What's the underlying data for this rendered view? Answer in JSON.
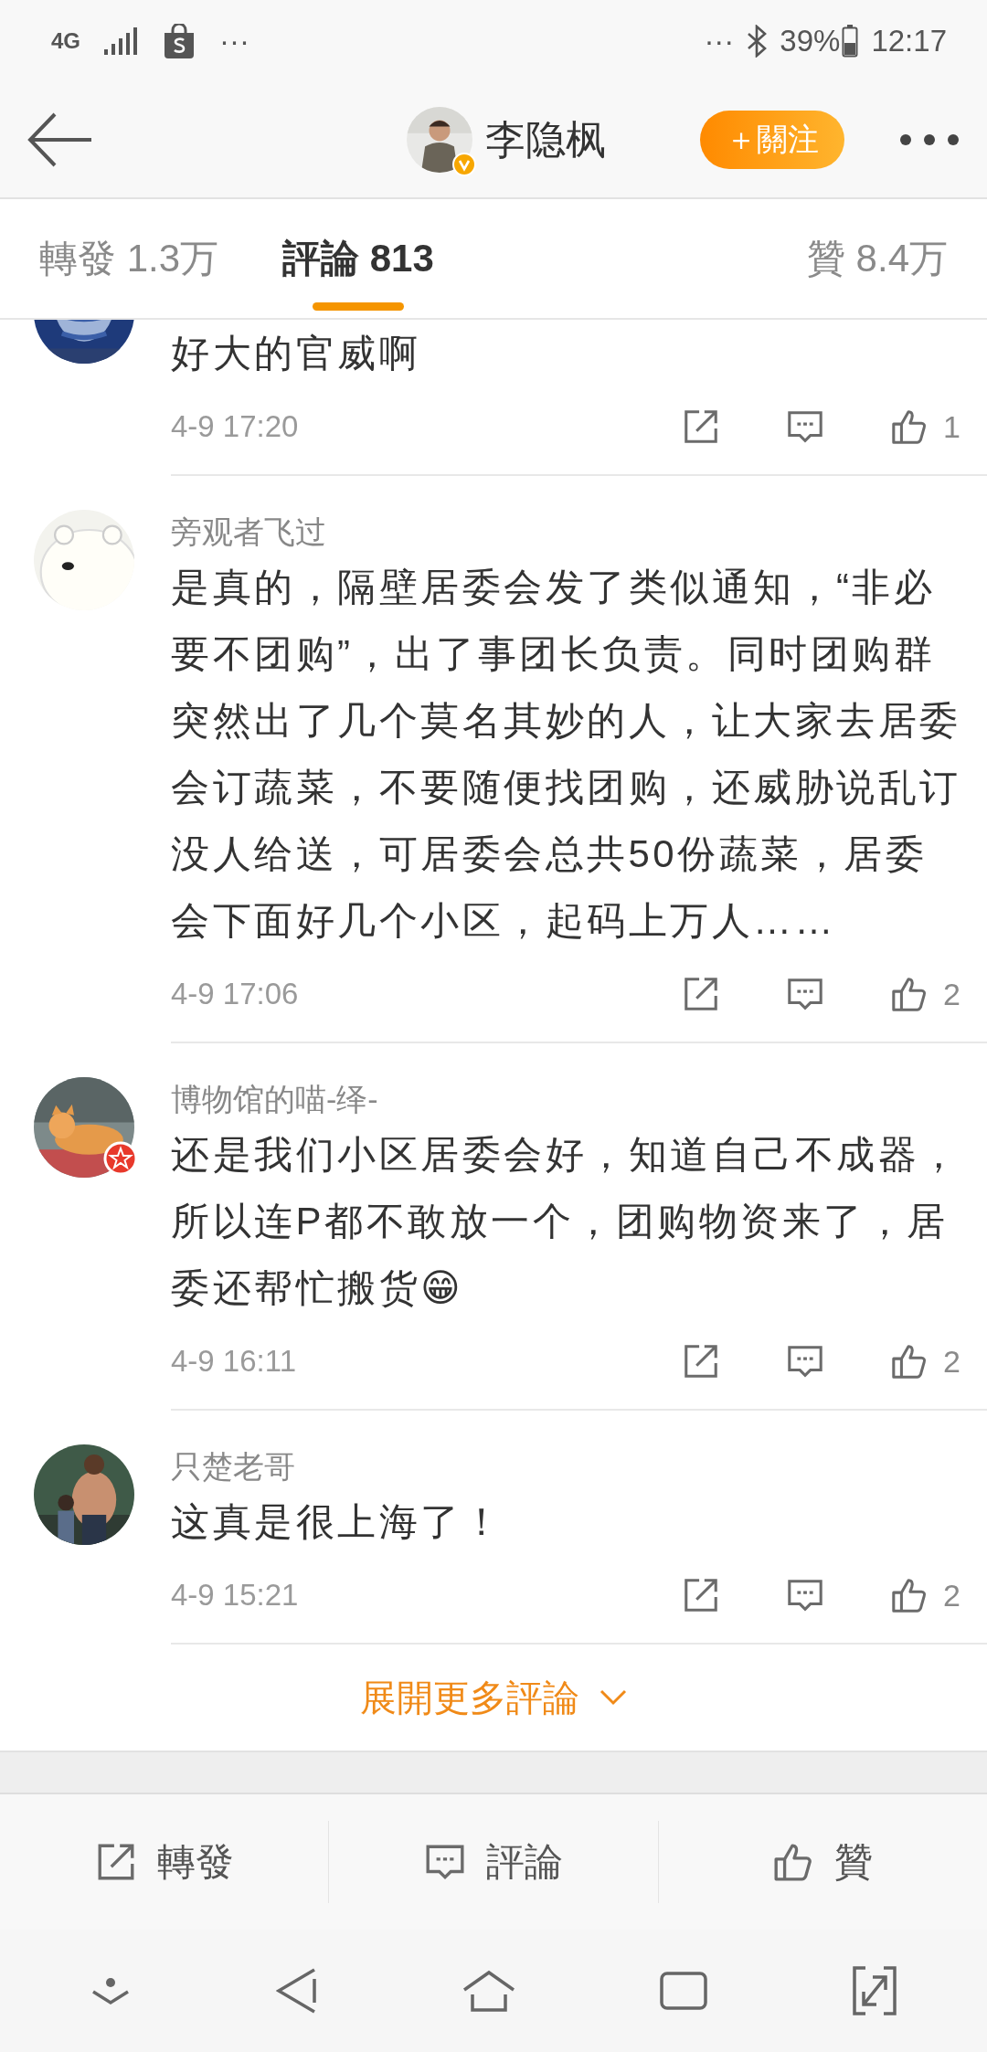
{
  "status_bar": {
    "network": "4G",
    "left_more": "···",
    "right_more": "···",
    "battery": "39%",
    "time": "12:17"
  },
  "header": {
    "name": "李隐枫",
    "verified": true,
    "follow_button": "＋關注"
  },
  "tabs": [
    {
      "label": "轉發 1.3万",
      "selected": false
    },
    {
      "label": "評論 813",
      "selected": true
    },
    {
      "label": "贊 8.4万",
      "selected": false
    }
  ],
  "comments": [
    {
      "text": "好大的官威啊",
      "time": "4-9 17:20",
      "likes": "1"
    },
    {
      "user": "旁观者飞过",
      "text": "是真的，隔壁居委会发了类似通知，“非必要不团购”，出了事团长负责。同时团购群突然出了几个莫名其妙的人，让大家去居委会订蔬菜，不要随便找团购，还威胁说乱订没人给送，可居委会总共50份蔬菜，居委会下面好几个小区，起码上万人……",
      "time": "4-9 17:06",
      "likes": "2"
    },
    {
      "user": "博物馆的喵-绎-",
      "star_badge": true,
      "text": "还是我们小区居委会好，知道自己不成器，所以连P都不敢放一个，团购物资来了，居委还帮忙搬货😁",
      "time": "4-9 16:11",
      "likes": "2"
    },
    {
      "user": "只楚老哥",
      "text": "这真是很上海了！",
      "time": "4-9 15:21",
      "likes": "2"
    }
  ],
  "expand_more": "展開更多評論",
  "action_bar": [
    {
      "kind": "share",
      "label": "轉發"
    },
    {
      "kind": "comment",
      "label": "評論"
    },
    {
      "kind": "like",
      "label": "贊"
    }
  ]
}
